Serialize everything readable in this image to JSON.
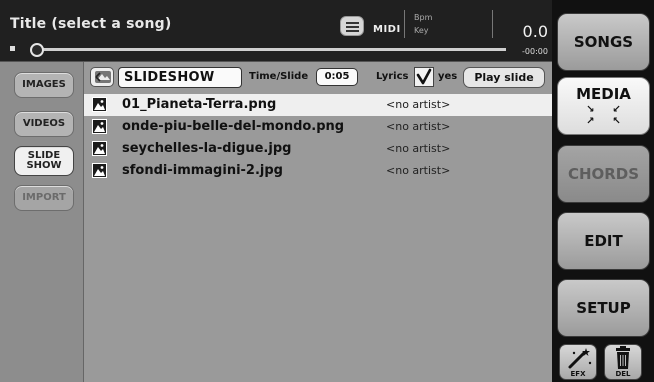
{
  "header": {
    "song_title": "Title (select a song)",
    "midi_label": "MIDI",
    "bpm_label": "Bpm",
    "key_label": "Key",
    "time_value": "0.0",
    "time_remaining": "-00:00",
    "progress": 0
  },
  "sidebar": {
    "items": [
      {
        "label": "IMAGES",
        "state": "normal"
      },
      {
        "label": "VIDEOS",
        "state": "normal"
      },
      {
        "label": "SLIDE\nSHOW",
        "state": "active"
      },
      {
        "label": "IMPORT",
        "state": "disabled"
      }
    ]
  },
  "toolbar": {
    "slideshow_name": "SLIDESHOW",
    "time_slide_label": "Time/Slide",
    "time_slide_value": "0:05",
    "lyrics_label": "Lyrics",
    "lyrics_checked": true,
    "yes_label": "yes",
    "play_label": "Play slide"
  },
  "files": [
    {
      "name": "01_Pianeta-Terra.png",
      "artist": "<no artist>"
    },
    {
      "name": "onde-piu-belle-del-mondo.png",
      "artist": "<no artist>"
    },
    {
      "name": "seychelles-la-digue.jpg",
      "artist": "<no artist>"
    },
    {
      "name": "sfondi-immagini-2.jpg",
      "artist": "<no artist>"
    }
  ],
  "nav": {
    "songs": "SONGS",
    "media": "MEDIA",
    "chords": "CHORDS",
    "edit": "EDIT",
    "setup": "SETUP",
    "efx": "EFX",
    "del": "DEL"
  },
  "icons": {
    "list": "list-icon",
    "back": "back-icon",
    "file": "image-file-icon",
    "efx": "magic-wand-icon",
    "del": "trash-icon"
  }
}
